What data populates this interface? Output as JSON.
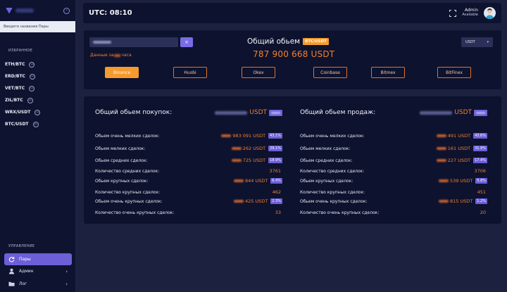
{
  "sidebar": {
    "search_placeholder": "Введите названия Пары",
    "favorites_title": "ИЗБРАННОЕ",
    "favorites": [
      {
        "label": "ETH/BTC"
      },
      {
        "label": "ERD/BTC"
      },
      {
        "label": "VET/BTC"
      },
      {
        "label": "ZIL/BTC"
      },
      {
        "label": "WRX/USDT"
      },
      {
        "label": "BTC/USDT"
      }
    ],
    "management_title": "УПРАВЛЕНИЕ",
    "menu": [
      {
        "label": "Пары",
        "icon": "refresh-icon",
        "active": true
      },
      {
        "label": "Админ",
        "icon": "user-icon",
        "active": false
      },
      {
        "label": "Лог",
        "icon": "folder-icon",
        "active": false
      }
    ]
  },
  "header": {
    "utc": "UTC: 08:10",
    "user_name": "Admin",
    "user_status": "Available"
  },
  "volume": {
    "data_label_start": "Данные за",
    "data_label_end": "часа",
    "title": "Общий обьем",
    "pair_badge": "BTC/USDT",
    "value": "787 900 668 USDT",
    "currency": "USDT",
    "clear_icon": "×",
    "exchanges": [
      {
        "label": "Binance",
        "active": true
      },
      {
        "label": "Huobi",
        "active": false
      },
      {
        "label": "Okex",
        "active": false
      },
      {
        "label": "Coinbase",
        "active": false
      },
      {
        "label": "Bitmex",
        "active": false
      },
      {
        "label": "BitFinex",
        "active": false
      }
    ]
  },
  "buys": {
    "title": "Общий обьем покупок:",
    "unit": "USDT",
    "rows": [
      {
        "label": "Обьем очень мелких сделок:",
        "value": "983 091 USDT",
        "pct": "43.1%"
      },
      {
        "label": "Обьем мелких сделок:",
        "value": "262 USDT",
        "pct": "29.1%"
      },
      {
        "label": "Обьем средних сделок:",
        "value": "725 USDT",
        "pct": "18.9%"
      },
      {
        "label": "Количество средних сделок:",
        "count": "3761"
      },
      {
        "label": "Обьем крупных сделок:",
        "value": "844 USDT",
        "pct": "6.4%"
      },
      {
        "label": "Количество крупных сделок:",
        "count": "462"
      },
      {
        "label": "Обьем очень крупных сделок:",
        "value": "425 USDT",
        "pct": "2.3%"
      },
      {
        "label": "Количество очень крупных сделок:",
        "count": "33"
      }
    ]
  },
  "sells": {
    "title": "Общий обьем продаж:",
    "unit": "USDT",
    "rows": [
      {
        "label": "Обьем очень мелких сделок:",
        "value": "491 USDT",
        "pct": "43.6%"
      },
      {
        "label": "Обьем мелких сделок:",
        "value": "161 USDT",
        "pct": "31.9%"
      },
      {
        "label": "Обьем средних сделок:",
        "value": "227 USDT",
        "pct": "17.4%"
      },
      {
        "label": "Количество средних сделок:",
        "count": "3706"
      },
      {
        "label": "Обьем крупных сделок:",
        "value": "539 USDT",
        "pct": "5.8%"
      },
      {
        "label": "Количество крупных сделок:",
        "count": "451"
      },
      {
        "label": "Обьем очень крупных сделок:",
        "value": "815 USDT",
        "pct": "1.2%"
      },
      {
        "label": "Количество очень крупных сделок:",
        "count": "20"
      }
    ]
  },
  "colors": {
    "accent_orange": "#f3802f",
    "accent_purple": "#6d5fd8",
    "panel": "#0d122e",
    "background": "#1c2140"
  }
}
